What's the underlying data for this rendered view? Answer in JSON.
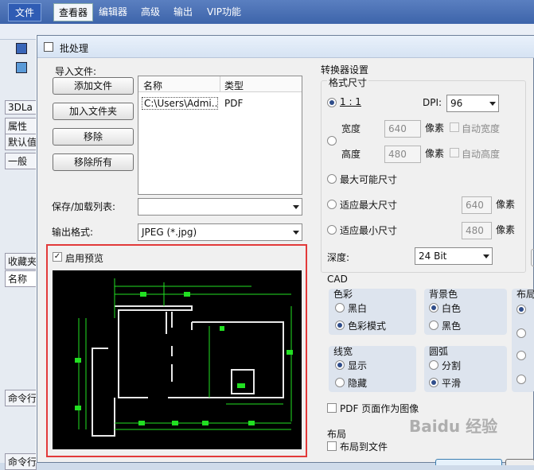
{
  "menubar": {
    "tabs": [
      "文件",
      "查看器",
      "编辑器",
      "高级",
      "输出",
      "VIP功能"
    ]
  },
  "left_panel": {
    "tab_3d": "3DLa",
    "props": "属性",
    "default": "默认值",
    "minus_item": "一般",
    "favorites": "收藏夹",
    "name": "名称",
    "cmd1": "命令行",
    "cmd2": "命令行"
  },
  "dialog": {
    "title": "批处理",
    "import_label": "导入文件:",
    "add_file": "添加文件",
    "add_folder": "加入文件夹",
    "remove": "移除",
    "remove_all": "移除所有",
    "file_list": {
      "columns": [
        "名称",
        "类型"
      ],
      "rows": [
        {
          "name": "C:\\Users\\Admi...",
          "type": "PDF"
        }
      ]
    },
    "save_load_label": "保存/加载列表:",
    "save_load_value": "",
    "output_format_label": "输出格式:",
    "output_format_value": "JPEG (*.jpg)",
    "enable_preview": "启用预览",
    "converter_settings": "转换器设置",
    "raster_size": "格式尺寸",
    "ratio_label": "1 : 1",
    "dpi_label": "DPI:",
    "dpi_value": "96",
    "width_label": "宽度",
    "width_value": "640",
    "height_label": "高度",
    "height_value": "480",
    "pixel_unit": "像素",
    "auto_width": "自动宽度",
    "auto_height": "自动高度",
    "max_possible": "最大可能尺寸",
    "fit_max": "适应最大尺寸",
    "fit_max_value": "640",
    "fit_min": "适应最小尺寸",
    "fit_min_value": "480",
    "depth_label": "深度:",
    "depth_value": "24 Bit",
    "cad_label": "CAD",
    "color_label": "色彩",
    "black_white": "黑白",
    "color_mode": "色彩模式",
    "bg_color_label": "背景色",
    "white": "白色",
    "black": "黑色",
    "layout_partial": "布局",
    "line_width_label": "线宽",
    "show": "显示",
    "hide": "隐藏",
    "arc_label": "圆弧",
    "split": "分割",
    "smooth": "平滑",
    "pdf_as_image": "PDF 页面作为图像",
    "layout_group": "布局",
    "layout_to_file": "布局到文件"
  },
  "watermark": "Baidu 经验",
  "colors": {
    "accent_red": "#e23a3a",
    "menubar": "#4a72b8",
    "cad_bg": "#000000",
    "cad_green": "#22e022"
  }
}
